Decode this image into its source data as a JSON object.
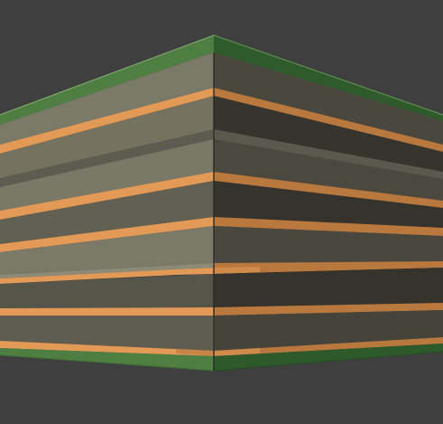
{
  "scene": {
    "subject": "layered-stack-corner-render",
    "colors": {
      "background": "#3f3f3f",
      "left_face_light": "#7a7866",
      "left_face_dark": "#55554a",
      "right_face_light": "#4b493f",
      "right_face_dark": "#34322b",
      "orange_band": "#e29a55",
      "orange_band_dark": "#b8783d",
      "green_cap": "#4f7e42",
      "green_cap_dark": "#2e5a2b",
      "edge_line": "#2a2a24"
    }
  }
}
